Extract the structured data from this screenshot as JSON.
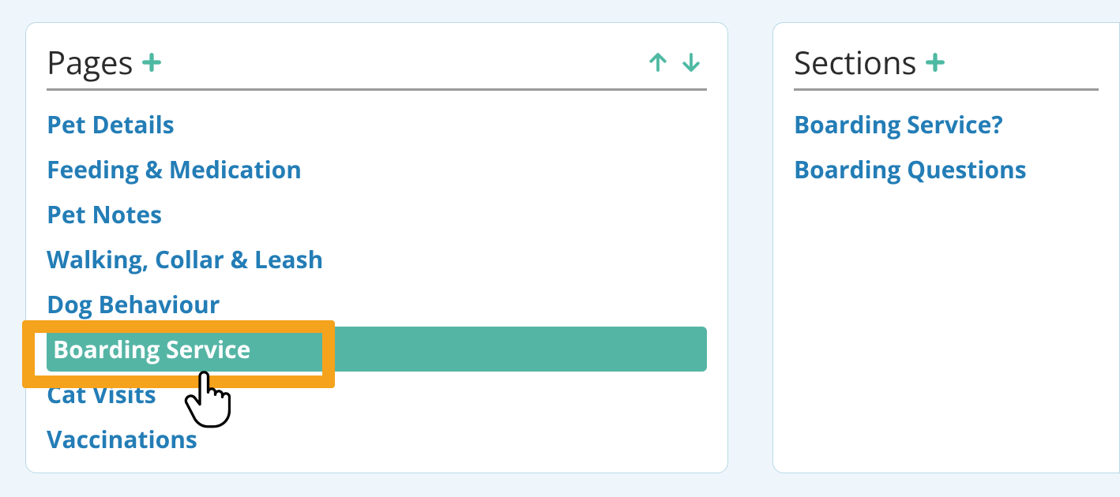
{
  "pages": {
    "title": "Pages",
    "items": [
      {
        "label": "Pet Details",
        "selected": false
      },
      {
        "label": "Feeding & Medication",
        "selected": false
      },
      {
        "label": "Pet Notes",
        "selected": false
      },
      {
        "label": "Walking, Collar & Leash",
        "selected": false
      },
      {
        "label": "Dog Behaviour",
        "selected": false
      },
      {
        "label": "Boarding Service",
        "selected": true
      },
      {
        "label": "Cat Visits",
        "selected": false
      },
      {
        "label": "Vaccinations",
        "selected": false
      }
    ]
  },
  "sections": {
    "title": "Sections",
    "items": [
      {
        "label": "Boarding Service?"
      },
      {
        "label": "Boarding Questions"
      }
    ]
  },
  "colors": {
    "accent": "#4fb9a3",
    "link": "#237db6",
    "highlight": "#f5a21c"
  }
}
